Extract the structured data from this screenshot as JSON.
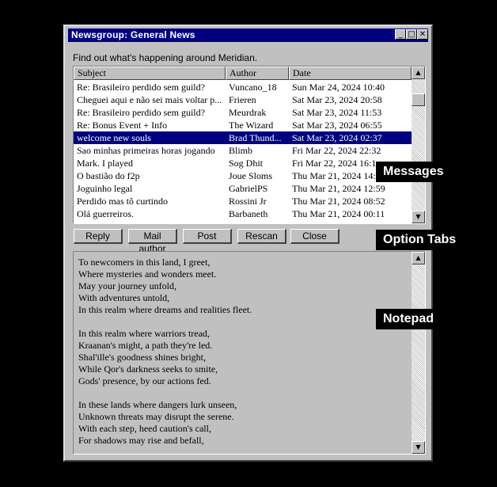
{
  "window": {
    "title": "Newsgroup: General News",
    "minimize_glyph": "_",
    "maximize_glyph": "□",
    "close_glyph": "✕"
  },
  "description": "Find out what's happening around Meridian.",
  "list": {
    "columns": [
      "Subject",
      "Author",
      "Date"
    ],
    "rows": [
      {
        "subject": "Re: Brasileiro perdido sem guild?",
        "author": "Vuncano_18",
        "date": "Sun Mar 24, 2024 10:40"
      },
      {
        "subject": "Cheguei aqui e não sei mais voltar p...",
        "author": "Frieren",
        "date": "Sat Mar 23, 2024 20:58"
      },
      {
        "subject": "Re: Brasileiro perdido sem guild?",
        "author": "Meurdrak",
        "date": "Sat Mar 23, 2024 11:53"
      },
      {
        "subject": "Re: Bonus Event + Info",
        "author": "The Wizard",
        "date": "Sat Mar 23, 2024 06:55"
      },
      {
        "subject": "welcome new souls",
        "author": "Brad Thund...",
        "date": "Sat Mar 23, 2024 02:37"
      },
      {
        "subject": "Sao minhas primeiras horas jogando",
        "author": "Blimb",
        "date": "Fri Mar 22, 2024 22:32"
      },
      {
        "subject": "Mark. I played",
        "author": "Sog Dhit",
        "date": "Fri Mar 22, 2024 16:1"
      },
      {
        "subject": "O bastião do f2p",
        "author": "Joue Sloms",
        "date": "Thu Mar 21, 2024 14:"
      },
      {
        "subject": "Joguinho legal",
        "author": "GabrielPS",
        "date": "Thu Mar 21, 2024 12:59"
      },
      {
        "subject": "Perdido mas tô curtindo",
        "author": "Rossini Jr",
        "date": "Thu Mar 21, 2024 08:52"
      },
      {
        "subject": "Olá guerreiros.",
        "author": "Barbaneth",
        "date": "Thu Mar 21, 2024 00:11"
      }
    ],
    "selected_index": 4
  },
  "actions": {
    "reply": "Reply",
    "mail_author": "Mail author",
    "post": "Post",
    "rescan": "Rescan",
    "close": "Close"
  },
  "notepad": {
    "text": "To newcomers in this land, I greet,\nWhere mysteries and wonders meet.\nMay your journey unfold,\nWith adventures untold,\nIn this realm where dreams and realities fleet.\n\nIn this realm where warriors tread,\nKraanan's might, a path they're led.\nShal'ille's goodness shines bright,\nWhile Qor's darkness seeks to smite,\nGods' presence, by our actions fed.\n\nIn these lands where dangers lurk unseen,\nUnknown threats may disrupt the serene.\nWith each step, heed caution's call,\nFor shadows may rise and befall,"
  },
  "annotations": {
    "messages": "Messages",
    "option_tabs": "Option Tabs",
    "notepad": "Notepad"
  },
  "scroll": {
    "up_glyph": "▲",
    "down_glyph": "▼"
  },
  "colors": {
    "titlebar": "#000080",
    "selection": "#000080",
    "face": "#c0c0c0"
  }
}
